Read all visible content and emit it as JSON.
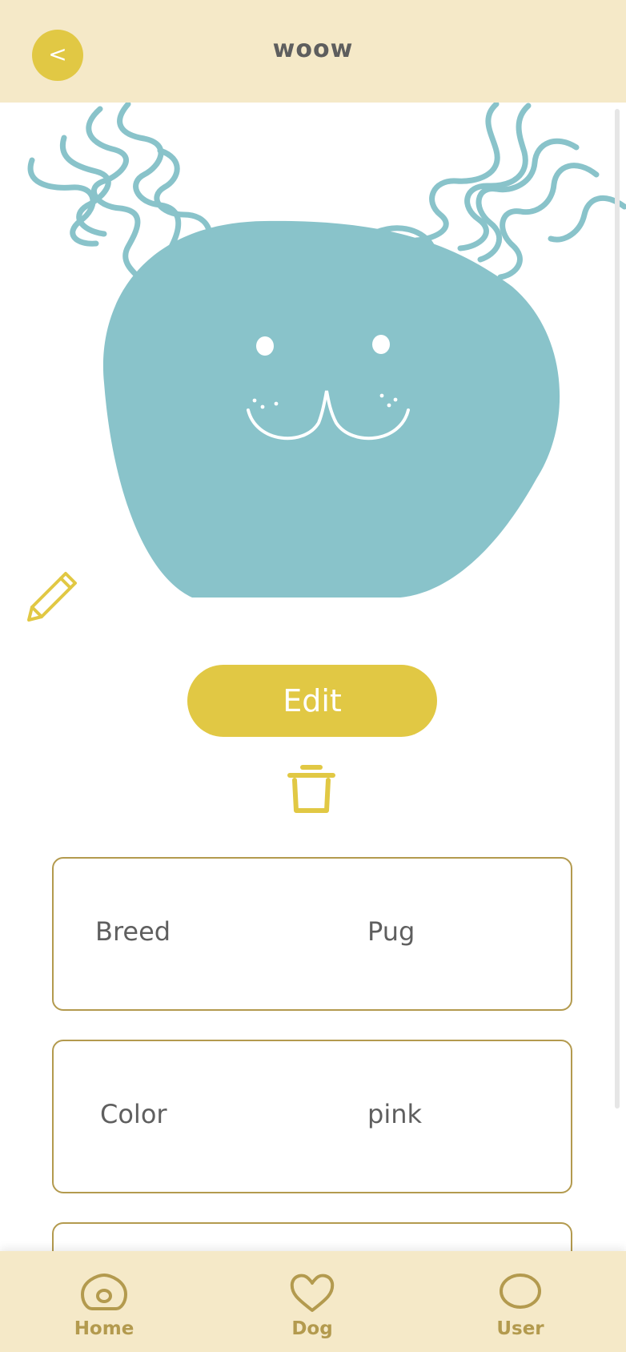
{
  "header": {
    "back_label": "<",
    "title": "woow"
  },
  "actions": {
    "edit_label": "Edit"
  },
  "details": [
    {
      "label": "Breed",
      "value": "Pug"
    },
    {
      "label": "Color",
      "value": "pink"
    },
    {
      "label": "",
      "value": ""
    }
  ],
  "nav": {
    "items": [
      {
        "label": "Home",
        "icon": "home-icon"
      },
      {
        "label": "Dog",
        "icon": "heart-icon"
      },
      {
        "label": "User",
        "icon": "user-icon"
      }
    ]
  },
  "colors": {
    "accent": "#e1c844",
    "header_bg": "#f5e9c8",
    "avatar": "#89c3ca",
    "border": "#b39a4e",
    "text": "#5f5f5f"
  }
}
